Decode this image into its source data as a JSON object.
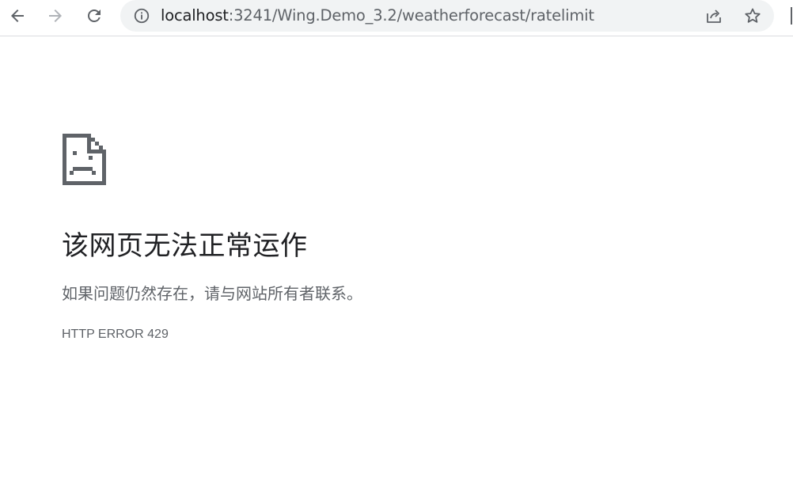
{
  "browser": {
    "url_host": "localhost",
    "url_path": ":3241/Wing.Demo_3.2/weatherforecast/ratelimit",
    "icons": {
      "back": "arrow-left",
      "forward": "arrow-right",
      "reload": "reload",
      "site_info": "info-circle",
      "share": "share",
      "bookmark": "star-outline"
    },
    "forward_enabled": false
  },
  "error_page": {
    "icon": "sad-tab-document",
    "title": "该网页无法正常运作",
    "message": "如果问题仍然存在，请与网站所有者联系。",
    "code": "HTTP ERROR 429"
  },
  "colors": {
    "text_primary": "#202124",
    "text_secondary": "#5f6368",
    "omnibox_bg": "#f1f3f4",
    "icon_disabled": "#b0b3b8"
  }
}
